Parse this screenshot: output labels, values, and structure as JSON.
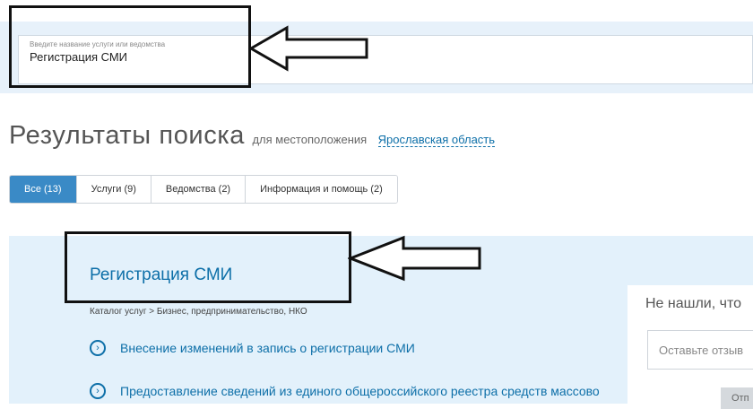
{
  "search": {
    "label": "Введите название услуги или ведомства",
    "value": "Регистрация СМИ"
  },
  "heading": {
    "title": "Результаты поиска",
    "subtitle": "для местоположения",
    "location": "Ярославская область"
  },
  "tabs": [
    {
      "label": "Все (13)",
      "active": true
    },
    {
      "label": "Услуги (9)",
      "active": false
    },
    {
      "label": "Ведомства (2)",
      "active": false
    },
    {
      "label": "Информация и помощь (2)",
      "active": false
    }
  ],
  "result": {
    "title": "Регистрация СМИ",
    "breadcrumb": "Каталог услуг > Бизнес, предпринимательство, НКО",
    "sub_items": [
      {
        "icon": "chevron-right-circle-icon",
        "label": "Внесение изменений в запись о регистрации СМИ"
      },
      {
        "icon": "chevron-right-circle-icon",
        "label": "Предоставление сведений из единого общероссийского реестра средств массово"
      }
    ]
  },
  "feedback": {
    "title": "Не нашли, что",
    "placeholder": "Оставьте отзыв",
    "button": "Отп"
  },
  "colors": {
    "accent": "#0d6fa8",
    "tab_active": "#3a8ac6",
    "search_band": "#e7f1fa",
    "results_bg": "#e3f1fb",
    "annotation": "#111111"
  }
}
